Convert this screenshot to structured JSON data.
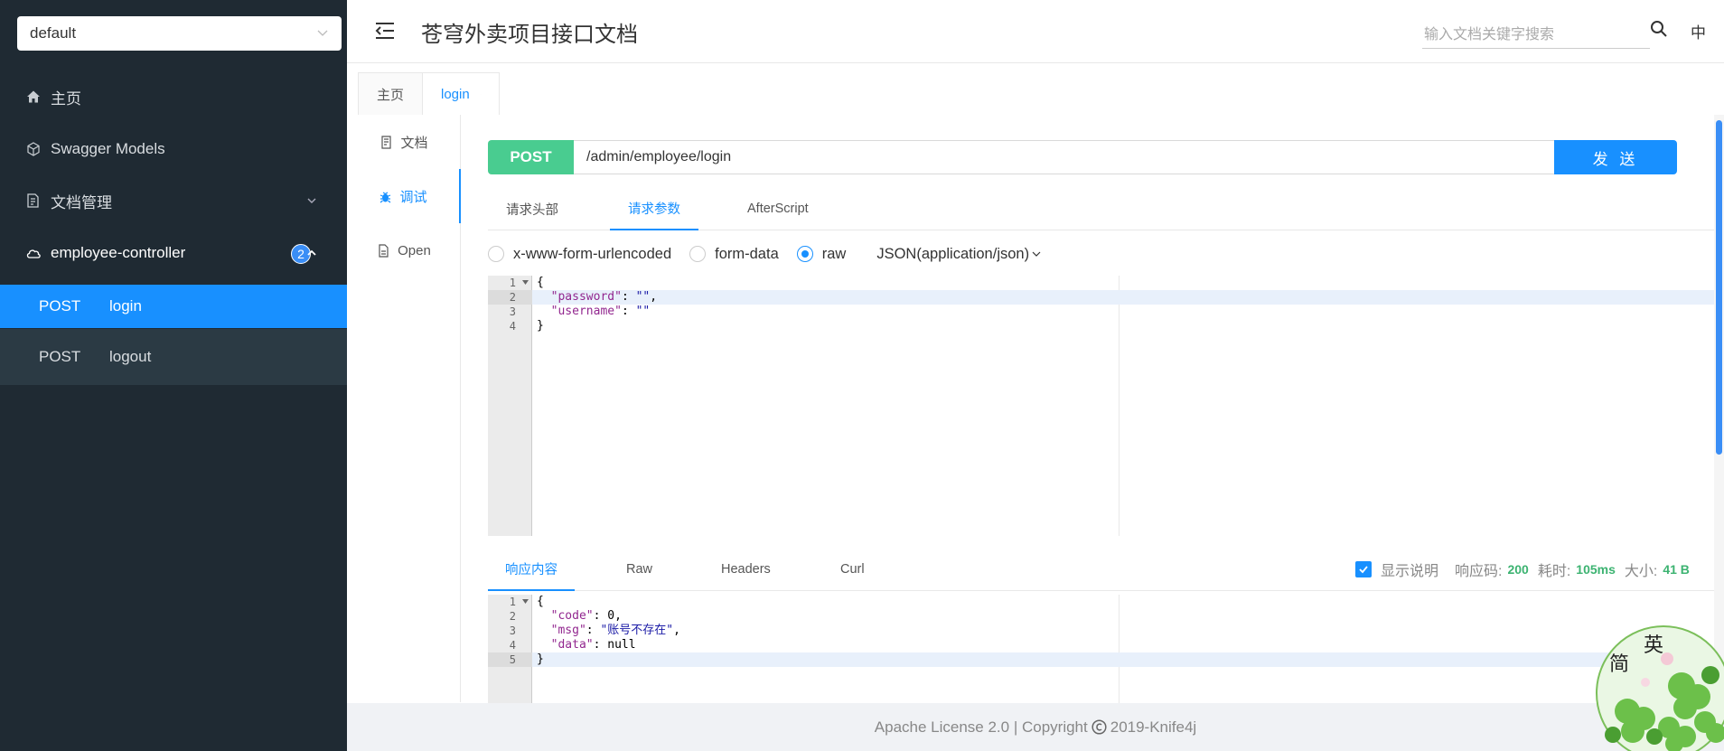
{
  "sidebar": {
    "group_select": "default",
    "items": [
      {
        "label": "主页",
        "icon": "home-icon"
      },
      {
        "label": "Swagger Models",
        "icon": "models-icon"
      },
      {
        "label": "文档管理",
        "icon": "doc-manage-icon"
      },
      {
        "label": "employee-controller",
        "icon": "cloud-icon",
        "badge": "2"
      }
    ],
    "endpoints": [
      {
        "method": "POST",
        "name": "login",
        "active": true
      },
      {
        "method": "POST",
        "name": "logout",
        "active": false
      }
    ]
  },
  "header": {
    "title": "苍穹外卖项目接口文档",
    "search_placeholder": "输入文档关键字搜索",
    "lang": "中"
  },
  "doc_tabs": [
    {
      "label": "主页"
    },
    {
      "label": "login",
      "active": true
    }
  ],
  "side_tabs": [
    {
      "label": "文档"
    },
    {
      "label": "调试",
      "active": true
    },
    {
      "label": "Open"
    }
  ],
  "request": {
    "method": "POST",
    "url": "/admin/employee/login",
    "send_label": "发 送",
    "tabs": [
      "请求头部",
      "请求参数",
      "AfterScript"
    ],
    "active_tab": "请求参数",
    "body_types": [
      "x-www-form-urlencoded",
      "form-data",
      "raw"
    ],
    "selected_body_type": "raw",
    "content_type": "JSON(application/json)",
    "body_lines": [
      "{",
      "  \"password\": \"\",",
      "  \"username\": \"\"",
      "}"
    ]
  },
  "response": {
    "tabs": [
      "响应内容",
      "Raw",
      "Headers",
      "Curl"
    ],
    "active_tab": "响应内容",
    "show_desc_label": "显示说明",
    "code_label": "响应码:",
    "code": "200",
    "time_label": "耗时:",
    "time": "105ms",
    "size_label": "大小:",
    "size": "41 B",
    "body_lines": [
      "{",
      "  \"code\": 0,",
      "  \"msg\": \"账号不存在\",",
      "  \"data\": null",
      "}"
    ]
  },
  "footer": {
    "text_before": "Apache License 2.0 | Copyright",
    "text_after": "2019-Knife4j"
  },
  "float_badge": {
    "char1": "英",
    "char2": "简"
  },
  "colors": {
    "sidebar_bg": "#1f2a33",
    "accent": "#1890ff",
    "post_green": "#49cc90"
  }
}
